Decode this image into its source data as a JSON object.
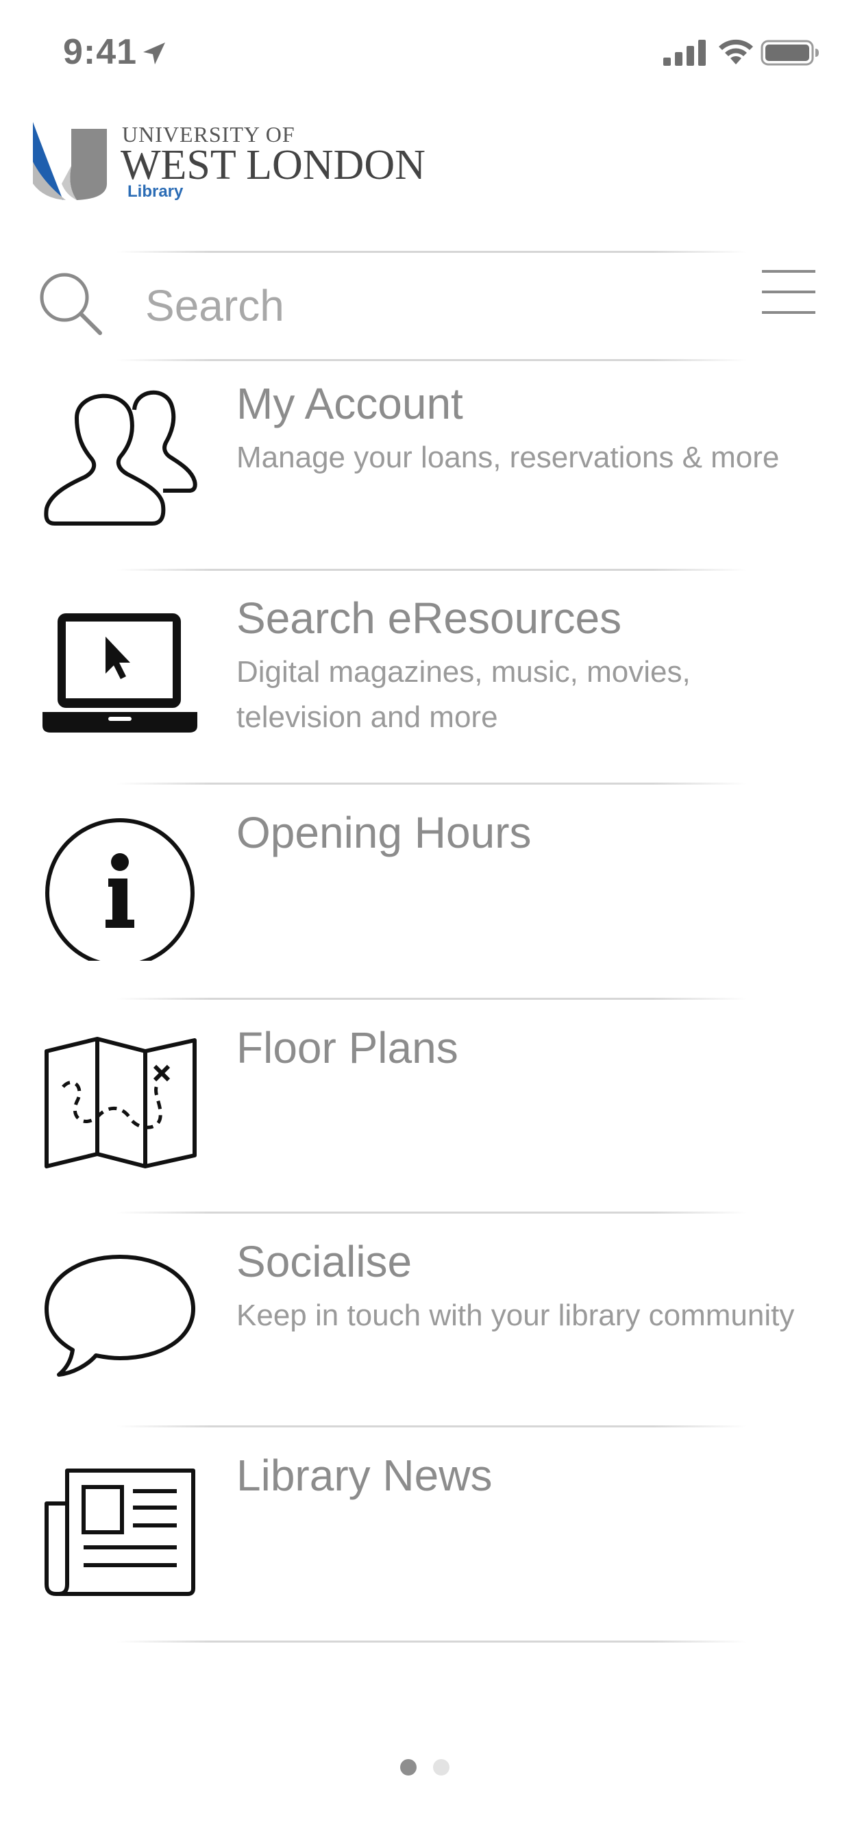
{
  "status_bar": {
    "time": "9:41",
    "icons": [
      "location-arrow-icon",
      "cellular-signal-icon",
      "wifi-icon",
      "battery-icon"
    ]
  },
  "logo": {
    "line1": "UNIVERSITY OF",
    "line2": "WEST LONDON",
    "line3": "Library",
    "colors": {
      "blue": "#1f5fae",
      "grey": "#7a7a7a"
    }
  },
  "search": {
    "placeholder": "Search",
    "value": ""
  },
  "menu": {
    "items": [
      {
        "icon": "users-icon",
        "title": "My Account",
        "subtitle": "Manage your loans, reservations & more"
      },
      {
        "icon": "laptop-icon",
        "title": "Search eResources",
        "subtitle": "Digital magazines, music, movies, television and more"
      },
      {
        "icon": "info-icon",
        "title": "Opening Hours",
        "subtitle": ""
      },
      {
        "icon": "map-icon",
        "title": "Floor Plans",
        "subtitle": ""
      },
      {
        "icon": "speech-bubble-icon",
        "title": "Socialise",
        "subtitle": "Keep in touch with your library community"
      },
      {
        "icon": "newspaper-icon",
        "title": "Library News",
        "subtitle": ""
      }
    ]
  },
  "pager": {
    "total_pages": 2,
    "current_page": 1
  },
  "colors": {
    "text_primary": "#8c8c8c",
    "text_secondary": "#9a9a9a",
    "icon_stroke": "#1a1a1a",
    "divider": "#d6d6d6"
  }
}
